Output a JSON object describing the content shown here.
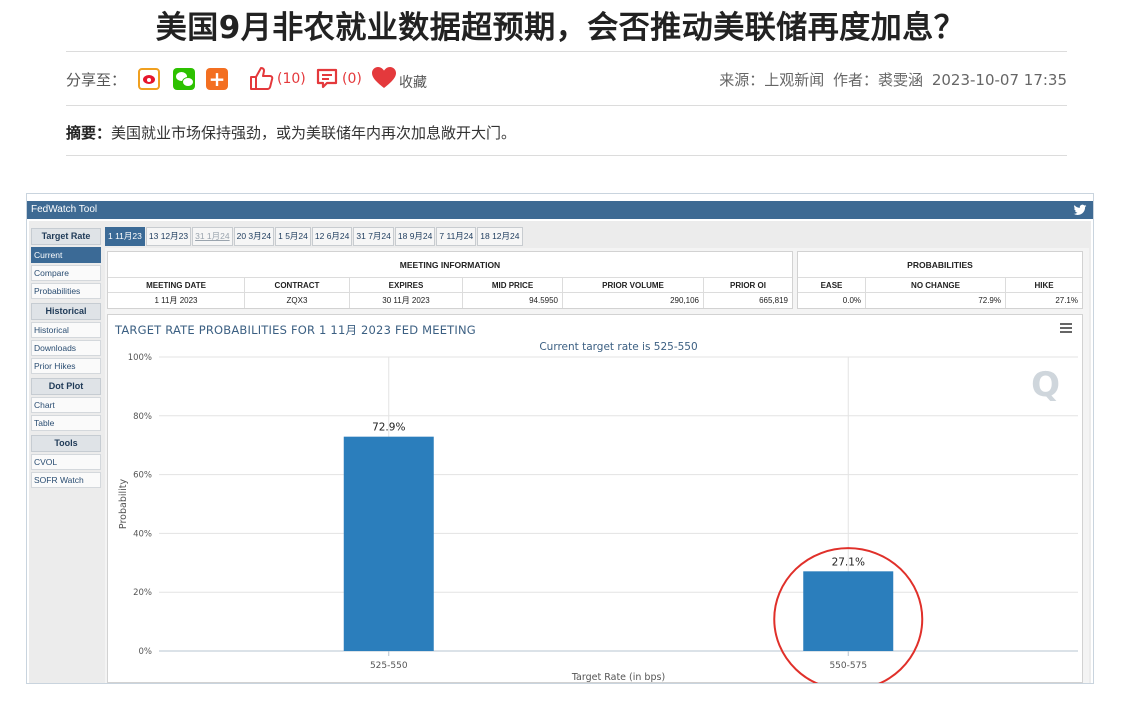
{
  "article": {
    "title": "美国9月非农就业数据超预期，会否推动美联储再度加息？",
    "share_label": "分享至：",
    "like_count": "(10)",
    "comment_count": "(0)",
    "favorite_label": "收藏",
    "source": "来源：上观新闻",
    "author": "作者：裘雯涵",
    "datetime": "2023-10-07 17:35",
    "summary_label": "摘要：",
    "summary_text": "美国就业市场保持强劲，或为美联储年内再次加息敞开大门。"
  },
  "fedwatch": {
    "app_title": "FedWatch Tool",
    "sidebar": [
      {
        "heading": "Target Rate",
        "items": [
          "Current",
          "Compare",
          "Probabilities"
        ]
      },
      {
        "heading": "Historical",
        "items": [
          "Historical",
          "Downloads",
          "Prior Hikes"
        ]
      },
      {
        "heading": "Dot Plot",
        "items": [
          "Chart",
          "Table"
        ]
      },
      {
        "heading": "Tools",
        "items": [
          "CVOL",
          "SOFR Watch"
        ]
      }
    ],
    "tabs": [
      "1 11月23",
      "13 12月23",
      "31 1月24",
      "20 3月24",
      "1 5月24",
      "12 6月24",
      "31 7月24",
      "18 9月24",
      "7 11月24",
      "18 12月24"
    ],
    "meeting_info": {
      "title": "MEETING INFORMATION",
      "headers": [
        "MEETING DATE",
        "CONTRACT",
        "EXPIRES",
        "MID PRICE",
        "PRIOR VOLUME",
        "PRIOR OI"
      ],
      "values": [
        "1 11月 2023",
        "ZQX3",
        "30 11月 2023",
        "94.5950",
        "290,106",
        "665,819"
      ]
    },
    "probabilities": {
      "title": "PROBABILITIES",
      "headers": [
        "EASE",
        "NO CHANGE",
        "HIKE"
      ],
      "values": [
        "0.0%",
        "72.9%",
        "27.1%"
      ]
    },
    "chart_title": "TARGET RATE PROBABILITIES FOR 1 11月 2023 FED MEETING",
    "chart_subtitle": "Current target rate is 525-550",
    "watermark": "Q",
    "colors": {
      "bar": "#2b7ebc",
      "header": "#3e6a93",
      "highlight_circle": "#e0302a"
    }
  },
  "chart_data": {
    "type": "bar",
    "title": "TARGET RATE PROBABILITIES FOR 1 11月 2023 FED MEETING",
    "subtitle": "Current target rate is 525-550",
    "categories": [
      "525-550",
      "550-575"
    ],
    "values": [
      72.9,
      27.1
    ],
    "data_labels": [
      "72.9%",
      "27.1%"
    ],
    "y_ticks": [
      "0%",
      "20%",
      "40%",
      "60%",
      "80%",
      "100%"
    ],
    "xlabel": "Target Rate (in bps)",
    "ylabel": "Probability",
    "ylim": [
      0,
      100
    ],
    "grid": true,
    "highlighted_category": "550-575"
  }
}
